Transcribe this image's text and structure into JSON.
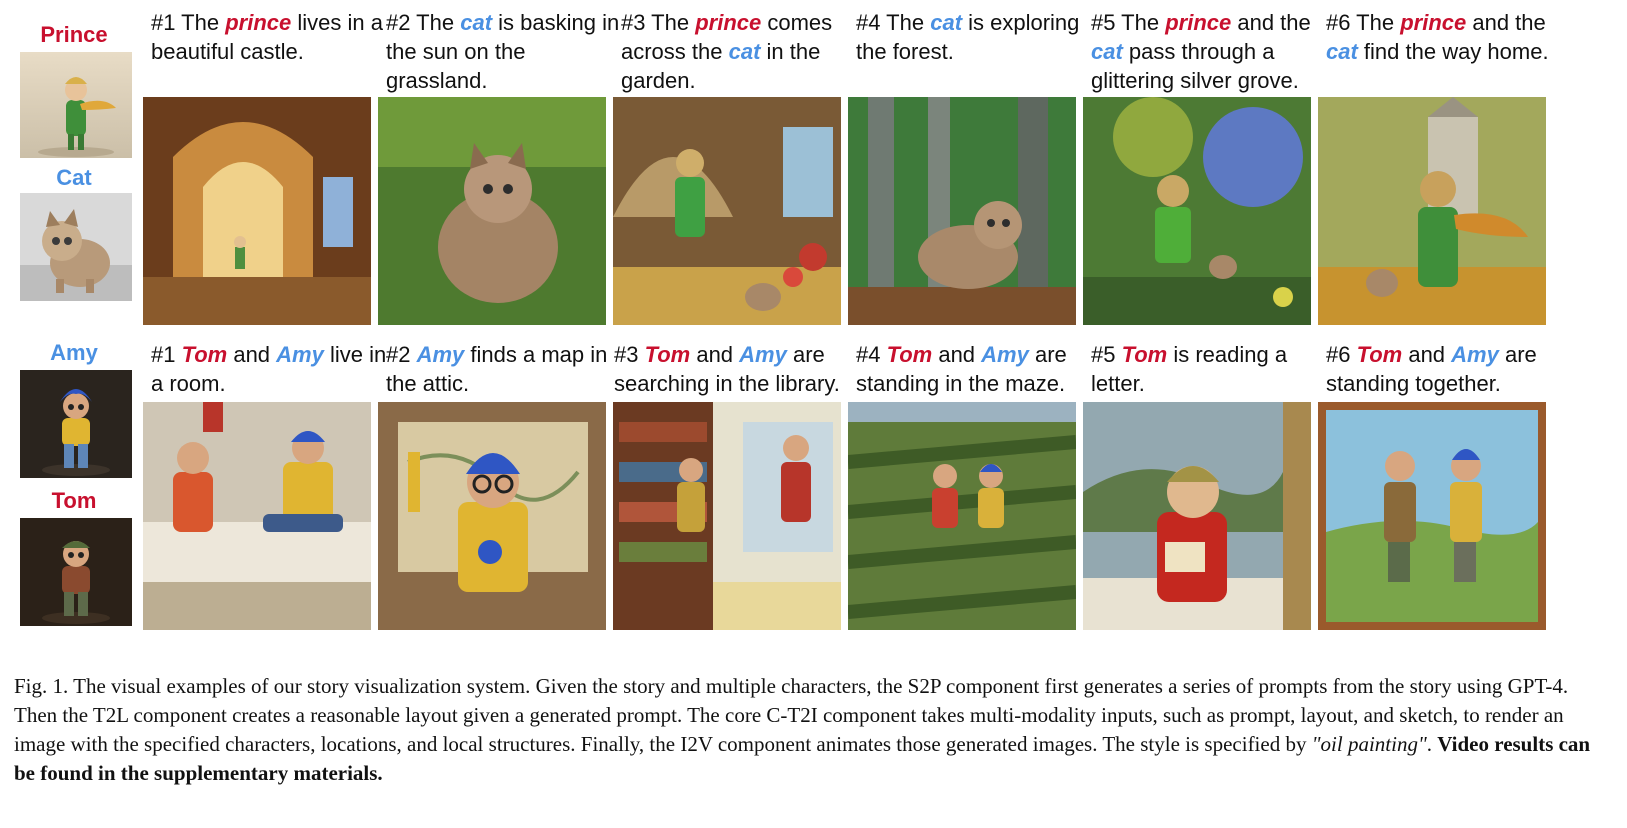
{
  "colors": {
    "red": "#c8102e",
    "blue": "#4a90e2",
    "text": "#111111"
  },
  "characters": [
    {
      "name": "Prince",
      "color": "#c8102e"
    },
    {
      "name": "Cat",
      "color": "#4a90e2"
    },
    {
      "name": "Amy",
      "color": "#4a90e2"
    },
    {
      "name": "Tom",
      "color": "#c8102e"
    }
  ],
  "rows": [
    {
      "panels": [
        {
          "caption": [
            {
              "t": "#1 The "
            },
            {
              "t": "prince",
              "c": "red"
            },
            {
              "t": " lives in a beautiful castle."
            }
          ],
          "scene": "castle hallway with arched doorway and a small green figure"
        },
        {
          "caption": [
            {
              "t": "#2 The "
            },
            {
              "t": "cat",
              "c": "blue"
            },
            {
              "t": " is basking in the sun on the grassland."
            }
          ],
          "scene": "fluffy cat sitting on sunlit grass"
        },
        {
          "caption": [
            {
              "t": "#3 The "
            },
            {
              "t": "prince",
              "c": "red"
            },
            {
              "t": " comes across the "
            },
            {
              "t": "cat",
              "c": "blue"
            },
            {
              "t": " in the garden."
            }
          ],
          "scene": "prince standing in a garden with flowers and a cat"
        },
        {
          "caption": [
            {
              "t": "#4 The "
            },
            {
              "t": "cat",
              "c": "blue"
            },
            {
              "t": " is exploring the forest."
            }
          ],
          "scene": "striped kitten walking in a green forest"
        },
        {
          "caption": [
            {
              "t": "#5 The "
            },
            {
              "t": "prince",
              "c": "red"
            },
            {
              "t": " and the "
            },
            {
              "t": "cat",
              "c": "blue"
            },
            {
              "t": " pass through a glittering silver grove."
            }
          ],
          "scene": "prince and cat among blue-flowered trees"
        },
        {
          "caption": [
            {
              "t": "#6 The "
            },
            {
              "t": "prince",
              "c": "red"
            },
            {
              "t": " and the "
            },
            {
              "t": "cat",
              "c": "blue"
            },
            {
              "t": " find the way home."
            }
          ],
          "scene": "prince and cat on a path toward a castle"
        }
      ]
    },
    {
      "panels": [
        {
          "caption": [
            {
              "t": "#1 "
            },
            {
              "t": "Tom",
              "c": "red"
            },
            {
              "t": " and "
            },
            {
              "t": "Amy",
              "c": "blue"
            },
            {
              "t": " live in a room."
            }
          ],
          "scene": "two doll figures sitting on a bed"
        },
        {
          "caption": [
            {
              "t": "#2 "
            },
            {
              "t": "Amy",
              "c": "blue"
            },
            {
              "t": " finds a map in the attic."
            }
          ],
          "scene": "figure with glasses in front of an old map"
        },
        {
          "caption": [
            {
              "t": "#3 "
            },
            {
              "t": "Tom",
              "c": "red"
            },
            {
              "t": " and "
            },
            {
              "t": "Amy",
              "c": "blue"
            },
            {
              "t": " are searching in the library."
            }
          ],
          "scene": "two figures in a library with bookshelves"
        },
        {
          "caption": [
            {
              "t": "#4 "
            },
            {
              "t": "Tom",
              "c": "red"
            },
            {
              "t": " and "
            },
            {
              "t": "Amy",
              "c": "blue"
            },
            {
              "t": " are standing in the maze."
            }
          ],
          "scene": "two figures in a hedge maze field"
        },
        {
          "caption": [
            {
              "t": "#5 "
            },
            {
              "t": "Tom",
              "c": "red"
            },
            {
              "t": " is reading a letter."
            }
          ],
          "scene": "boy in red sweater reading a letter"
        },
        {
          "caption": [
            {
              "t": "#6 "
            },
            {
              "t": "Tom",
              "c": "red"
            },
            {
              "t": " and "
            },
            {
              "t": "Amy",
              "c": "blue"
            },
            {
              "t": " are standing together."
            }
          ],
          "scene": "two figures standing together outdoors in a framed painting"
        }
      ]
    }
  ],
  "figure_caption": {
    "lead": "Fig. 1.  The visual examples of our story visualization system. Given the story and multiple characters, the S2P component first generates a series of prompts from the story using GPT-4. Then the T2L component creates a reasonable layout given a generated prompt. The core C-T2I component takes multi-modality inputs, such as prompt, layout, and sketch, to render an image with the specified characters, locations, and local structures. Finally, the I2V component animates those generated images. The style is specified by ",
    "style_quote": "\"oil painting\"",
    "period": ". ",
    "bold_tail": "Video results can be found in the supplementary materials."
  }
}
